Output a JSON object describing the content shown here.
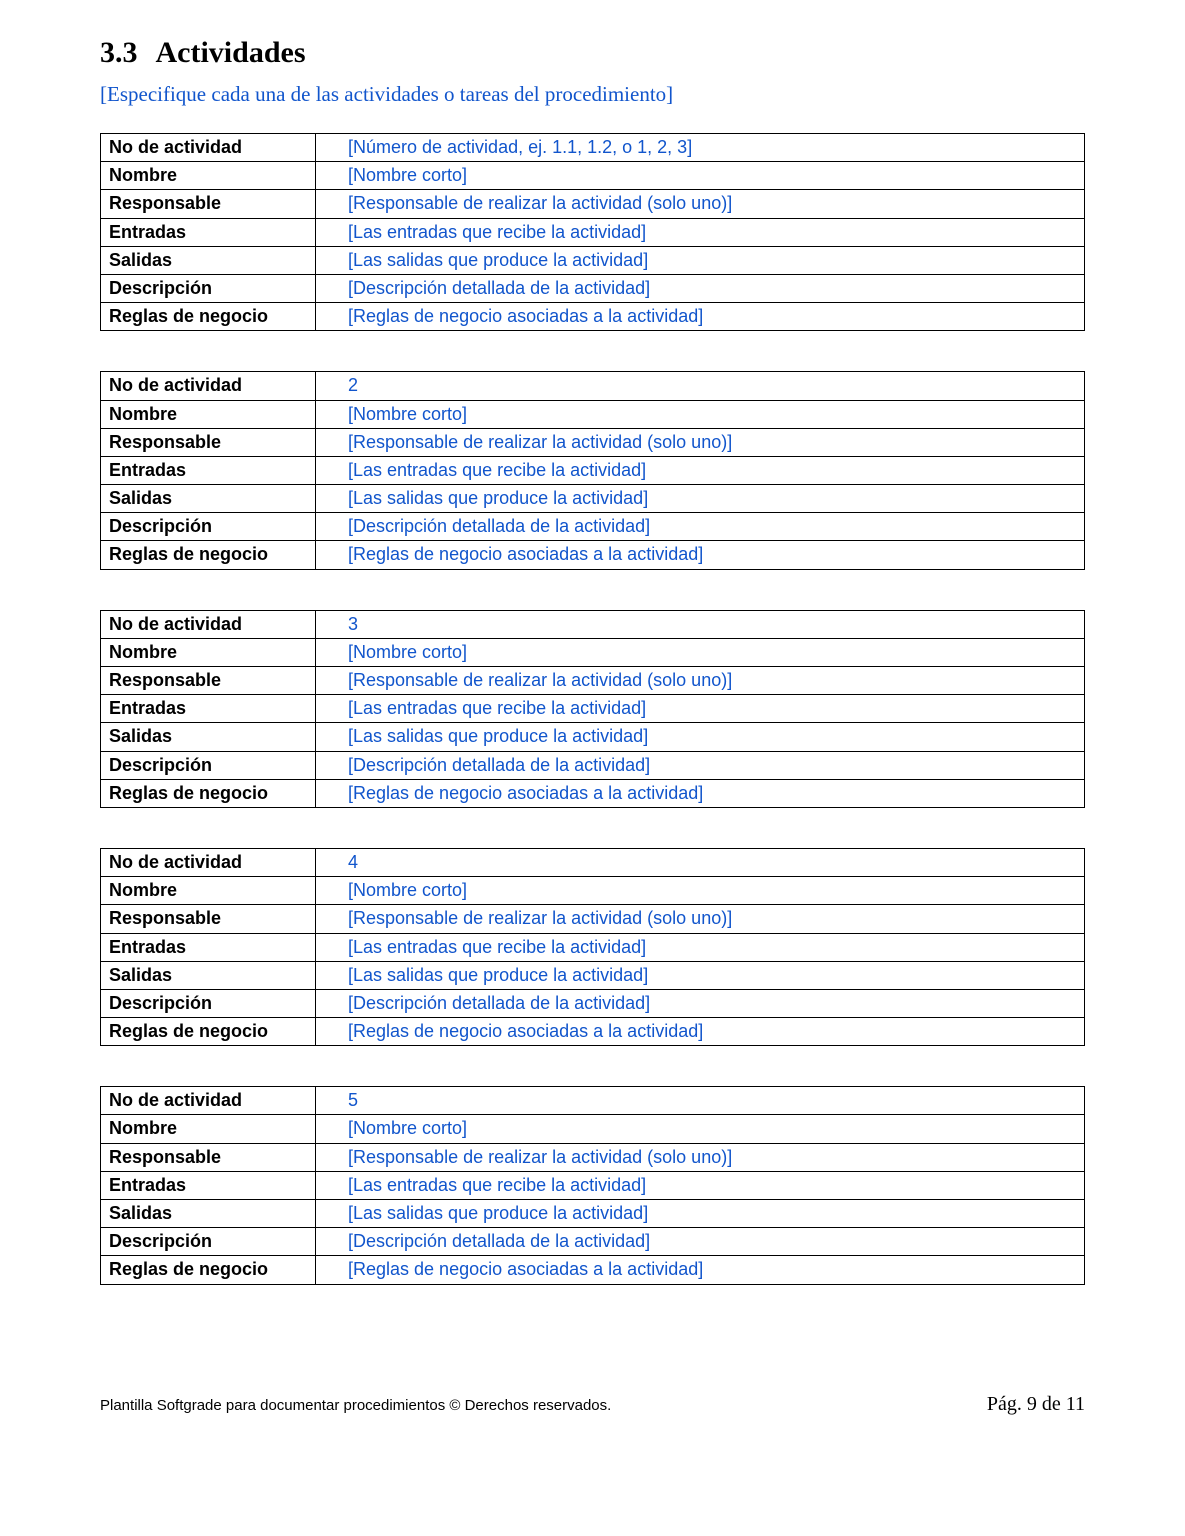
{
  "heading": {
    "number": "3.3",
    "title": "Actividades"
  },
  "instruction": "[Especifique cada una de las actividades o tareas del procedimiento]",
  "row_labels": {
    "no": "No de actividad",
    "nombre": "Nombre",
    "responsable": "Responsable",
    "entradas": "Entradas",
    "salidas": "Salidas",
    "descripcion": "Descripción",
    "reglas": "Reglas de negocio"
  },
  "activities": [
    {
      "no": "[Número de actividad, ej. 1.1, 1.2, o 1, 2, 3]",
      "nombre": "[Nombre corto]",
      "responsable": "[Responsable de realizar la actividad (solo uno)]",
      "entradas": "[Las entradas que recibe la actividad]",
      "salidas": "[Las salidas que produce la actividad]",
      "descripcion": "[Descripción detallada de la actividad]",
      "reglas": "[Reglas de negocio asociadas a la actividad]"
    },
    {
      "no": "2",
      "nombre": "[Nombre corto]",
      "responsable": "[Responsable de realizar la actividad (solo uno)]",
      "entradas": "[Las entradas que recibe la actividad]",
      "salidas": "[Las salidas que produce la actividad]",
      "descripcion": "[Descripción detallada de la actividad]",
      "reglas": "[Reglas de negocio asociadas a la actividad]"
    },
    {
      "no": "3",
      "nombre": "[Nombre corto]",
      "responsable": "[Responsable de realizar la actividad (solo uno)]",
      "entradas": "[Las entradas que recibe la actividad]",
      "salidas": "[Las salidas que produce la actividad]",
      "descripcion": "[Descripción detallada de la actividad]",
      "reglas": "[Reglas de negocio asociadas a la actividad]"
    },
    {
      "no": "4",
      "nombre": "[Nombre corto]",
      "responsable": "[Responsable de realizar la actividad (solo uno)]",
      "entradas": "[Las entradas que recibe la actividad]",
      "salidas": "[Las salidas que produce la actividad]",
      "descripcion": "[Descripción detallada de la actividad]",
      "reglas": "[Reglas de negocio asociadas a la actividad]"
    },
    {
      "no": "5",
      "nombre": "[Nombre corto]",
      "responsable": "[Responsable de realizar la actividad (solo uno)]",
      "entradas": "[Las entradas que recibe la actividad]",
      "salidas": "[Las salidas que produce la actividad]",
      "descripcion": "[Descripción detallada de la actividad]",
      "reglas": "[Reglas de negocio asociadas a la actividad]"
    }
  ],
  "footer": {
    "left": "Plantilla Softgrade para documentar procedimientos © Derechos reservados.",
    "right": "Pág. 9 de 11"
  }
}
